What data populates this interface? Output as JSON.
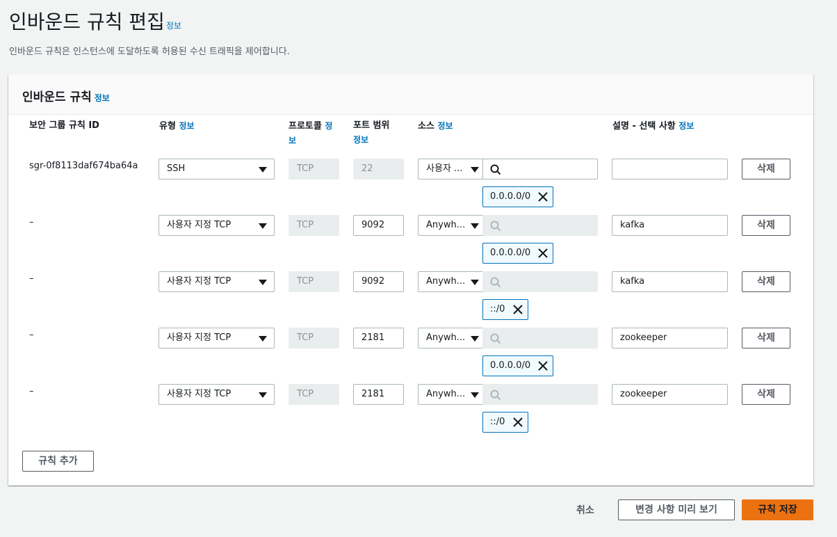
{
  "header": {
    "title": "인바운드 규칙 편집",
    "info": "정보",
    "subtitle": "인바운드 규칙은 인스턴스에 도달하도록 허용된 수신 트래픽을 제어합니다."
  },
  "panel": {
    "title": "인바운드 규칙",
    "info": "정보"
  },
  "columns": {
    "rule_id": "보안 그룹 규칙 ID",
    "type": "유형",
    "protocol_a": "프로토콜",
    "protocol_b": "",
    "port_range": "포트 범위",
    "source": "소스",
    "description": "설명 - 선택 사항",
    "info": "정보"
  },
  "rules": [
    {
      "id": "sgr-0f8113daf674ba64a",
      "type": "SSH",
      "protocol": "TCP",
      "port": "22",
      "source_type": "사용자 ...",
      "source_search": "",
      "cidr": "0.0.0.0/0",
      "description": "",
      "delete_label": "삭제"
    },
    {
      "id": "–",
      "type": "사용자 지정 TCP",
      "protocol": "TCP",
      "port": "9092",
      "source_type": "Anywh...",
      "source_search": "",
      "cidr": "0.0.0.0/0",
      "description": "kafka",
      "delete_label": "삭제"
    },
    {
      "id": "–",
      "type": "사용자 지정 TCP",
      "protocol": "TCP",
      "port": "9092",
      "source_type": "Anywh...",
      "source_search": "",
      "cidr": "::/0",
      "description": "kafka",
      "delete_label": "삭제"
    },
    {
      "id": "–",
      "type": "사용자 지정 TCP",
      "protocol": "TCP",
      "port": "2181",
      "source_type": "Anywh...",
      "source_search": "",
      "cidr": "0.0.0.0/0",
      "description": "zookeeper",
      "delete_label": "삭제"
    },
    {
      "id": "–",
      "type": "사용자 지정 TCP",
      "protocol": "TCP",
      "port": "2181",
      "source_type": "Anywh...",
      "source_search": "",
      "cidr": "::/0",
      "description": "zookeeper",
      "delete_label": "삭제"
    }
  ],
  "add_rule_label": "규칙 추가",
  "footer": {
    "cancel": "취소",
    "preview": "변경 사항 미리 보기",
    "save": "규칙 저장"
  },
  "colors": {
    "accent": "#ec7211",
    "link": "#0073bb",
    "token_border": "#0073bb"
  }
}
